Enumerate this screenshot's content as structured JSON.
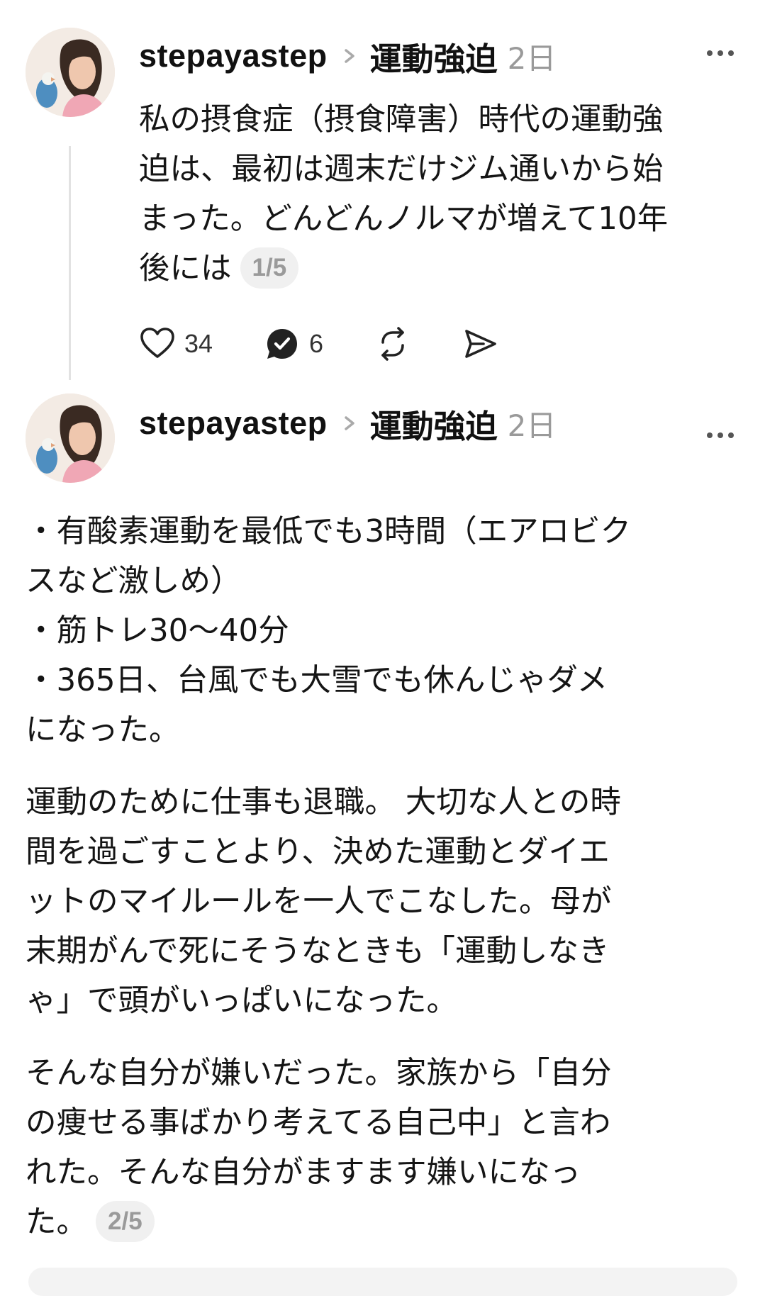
{
  "posts": [
    {
      "username": "stepayastep",
      "topic": "運動強迫",
      "time": "2日",
      "lines": [
        "私の摂食症（摂食障害）時代の運動強",
        "迫は、最初は週末だけジム通いから始",
        "まった。どんどんノルマが増えて10年",
        "後には"
      ],
      "pager": "1/5",
      "likes": "34",
      "replies": "6"
    },
    {
      "username": "stepayastep",
      "topic": "運動強迫",
      "time": "2日",
      "paragraphs": [
        [
          "・有酸素運動を最低でも3時間（エアロビク",
          "スなど激しめ）",
          "・筋トレ30〜40分",
          "・365日、台風でも大雪でも休んじゃダメ",
          "になった。"
        ],
        [
          "運動のために仕事も退職。 大切な人との時",
          "間を過ごすことより、決めた運動とダイエ",
          "ットのマイルールを一人でこなした。母が",
          "末期がんで死にそうなときも「運動しなき",
          "ゃ」で頭がいっぱいになった。"
        ],
        [
          "そんな自分が嫌いだった。家族から「自分",
          "の痩せる事ばかり考えてる自己中」と言わ",
          "れた。そんな自分がますます嫌いになっ",
          "た。"
        ]
      ],
      "pager": "2/5"
    }
  ],
  "icons": {
    "more": "more-horizontal-icon",
    "chevron": "chevron-right-icon",
    "like": "heart-icon",
    "reply": "reply-bubble-icon",
    "repost": "repost-icon",
    "share": "send-icon"
  },
  "colors": {
    "text": "#151515",
    "muted": "#9a9a9a",
    "pager_bg": "#f0f0f0",
    "thread_line": "#e2e2e2"
  }
}
